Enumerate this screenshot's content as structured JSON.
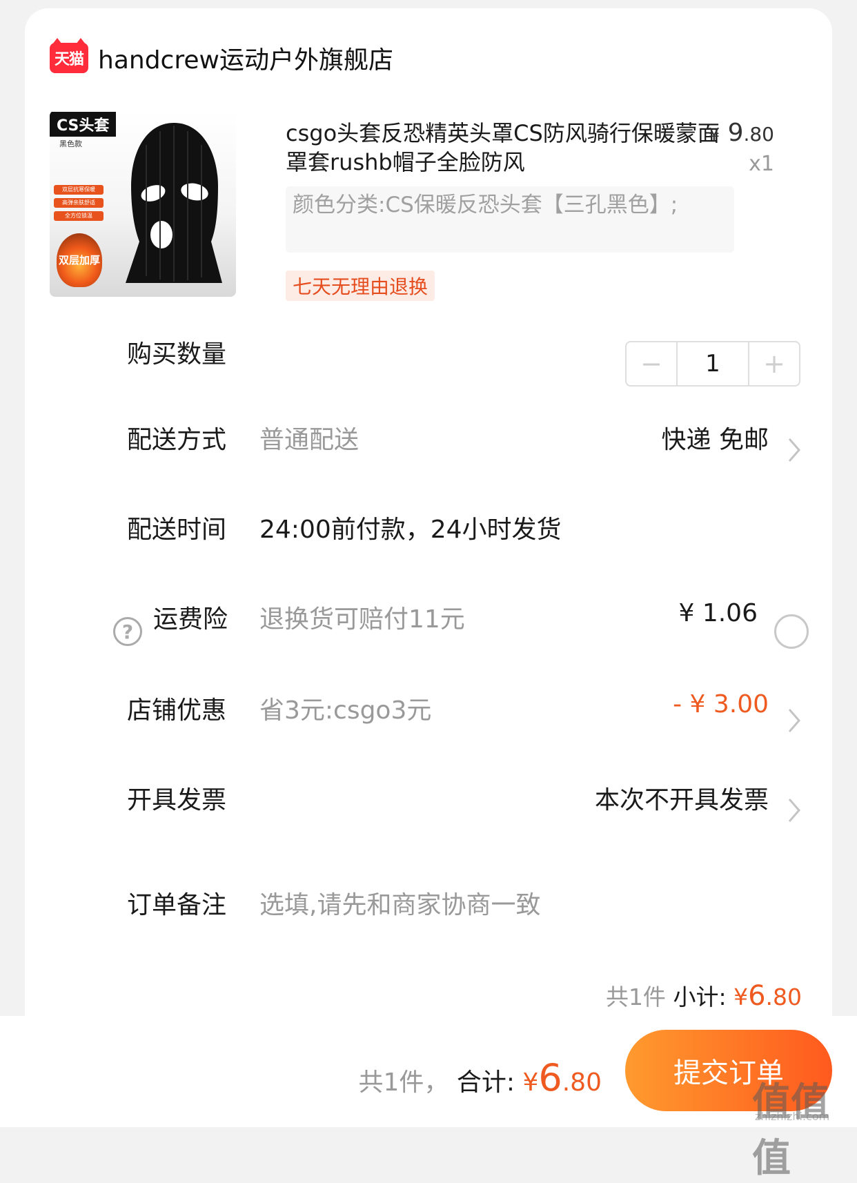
{
  "store": {
    "logo_text": "天猫",
    "name": "handcrew运动户外旗舰店"
  },
  "product": {
    "thumb": {
      "tag": "CS头套",
      "sub": "黑色款",
      "pills": [
        "双层抗寒保暖",
        "高弹亲肤舒适",
        "全方位锁温"
      ],
      "badge": "双层加厚"
    },
    "title": "csgo头套反恐精英头罩CS防风骑行保暖蒙面罩套rushb帽子全脸防风",
    "price_currency": "¥",
    "price_int": "9",
    "price_dec": ".80",
    "qty": "x1",
    "sku": "颜色分类:CS保暖反恐头套【三孔黑色】;",
    "tag": "七天无理由退换"
  },
  "quantity": {
    "label": "购买数量",
    "minus": "−",
    "value": "1",
    "plus": "+"
  },
  "delivery": {
    "label": "配送方式",
    "desc": "普通配送",
    "right": "快递 免邮"
  },
  "delivery_time": {
    "label": "配送时间",
    "desc": "24:00前付款，24小时发货"
  },
  "insurance": {
    "label": "运费险",
    "help": "?",
    "desc": "退换货可赔付11元",
    "price": "¥ 1.06"
  },
  "discount": {
    "label": "店铺优惠",
    "desc": "省3元:csgo3元",
    "value": "- ¥ 3.00"
  },
  "invoice": {
    "label": "开具发票",
    "right": "本次不开具发票"
  },
  "note": {
    "label": "订单备注",
    "placeholder": "选填,请先和商家协商一致"
  },
  "subtotal": {
    "count": "共1件",
    "label": "小计:",
    "currency": "¥",
    "int": "6",
    "dec": ".80"
  },
  "footer": {
    "count": "共1件，",
    "label": "合计:",
    "currency": "¥",
    "int": "6",
    "dec": ".80",
    "submit": "提交订单"
  },
  "watermark": {
    "text": "值值值",
    "domain": "zhizhizhi.com"
  }
}
